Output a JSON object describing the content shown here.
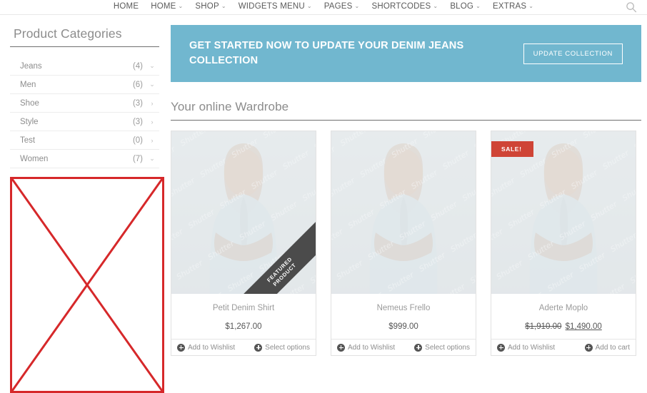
{
  "nav": {
    "items": [
      {
        "label": "HOME",
        "has_caret": false
      },
      {
        "label": "HOME",
        "has_caret": true
      },
      {
        "label": "SHOP",
        "has_caret": true
      },
      {
        "label": "WIDGETS MENU",
        "has_caret": true
      },
      {
        "label": "PAGES",
        "has_caret": true
      },
      {
        "label": "SHORTCODES",
        "has_caret": true
      },
      {
        "label": "BLOG",
        "has_caret": true
      },
      {
        "label": "EXTRAS",
        "has_caret": true
      }
    ],
    "caret_glyph": "⌄",
    "search_icon": "search-icon"
  },
  "sidebar": {
    "widget_title": "Product Categories",
    "categories": [
      {
        "label": "Jeans",
        "count": "(4)",
        "arrow": "⌄",
        "state": "expandable-down"
      },
      {
        "label": "Men",
        "count": "(6)",
        "arrow": "⌄",
        "state": "expandable-down"
      },
      {
        "label": "Shoe",
        "count": "(3)",
        "arrow": "›",
        "state": "expandable-right"
      },
      {
        "label": "Style",
        "count": "(3)",
        "arrow": "›",
        "state": "expandable-right"
      },
      {
        "label": "Test",
        "count": "(0)",
        "arrow": "›",
        "state": "expandable-right"
      },
      {
        "label": "Women",
        "count": "(7)",
        "arrow": "⌄",
        "state": "expandable-down"
      }
    ],
    "broken_image": {
      "name": "broken-image-placeholder",
      "border_color": "#d6282a"
    }
  },
  "banner": {
    "headline": "GET STARTED NOW TO UPDATE YOUR DENIM JEANS COLLECTION",
    "button_label": "UPDATE COLLECTION",
    "background_color": "#71b7cf",
    "text_color": "#ffffff"
  },
  "main": {
    "section_title": "Your online Wardrobe",
    "products": [
      {
        "name": "Petit Denim Shirt",
        "price": "$1,267.00",
        "price_old": null,
        "on_sale": false,
        "featured": true,
        "featured_label_line1": "FEATURED",
        "featured_label_line2": "PRODUCT",
        "wishlist_label": "Add to Wishlist",
        "cart_label": "Select options"
      },
      {
        "name": "Nemeus Frello",
        "price": "$999.00",
        "price_old": null,
        "on_sale": false,
        "featured": false,
        "featured_label_line1": "",
        "featured_label_line2": "",
        "wishlist_label": "Add to Wishlist",
        "cart_label": "Select options"
      },
      {
        "name": "Aderte Moplo",
        "price": "$1,490.00",
        "price_old": "$1,910.00",
        "on_sale": true,
        "sale_label": "SALE!",
        "featured": false,
        "featured_label_line1": "",
        "featured_label_line2": "",
        "wishlist_label": "Add to Wishlist",
        "cart_label": "Add to cart"
      }
    ]
  },
  "colors": {
    "sale_badge": "#cf4436",
    "ribbon": "#4b4b4b",
    "banner": "#71b7cf"
  }
}
